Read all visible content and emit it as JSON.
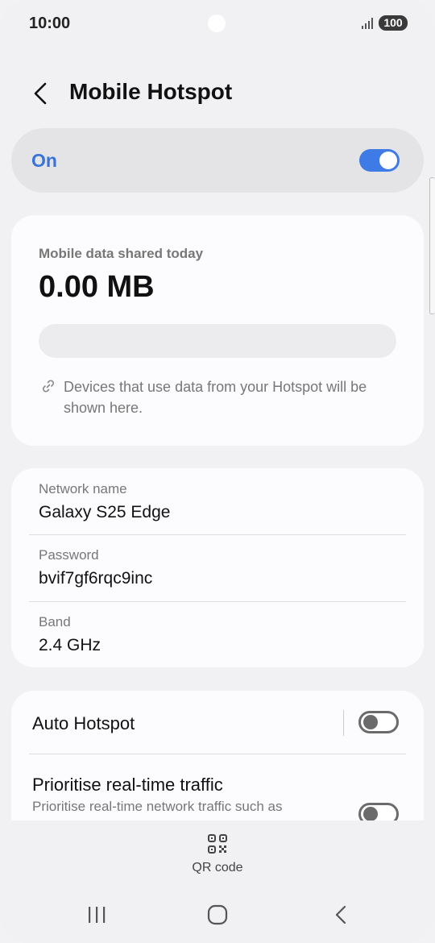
{
  "status": {
    "time": "10:00",
    "battery": "100"
  },
  "header": {
    "title": "Mobile Hotspot"
  },
  "hotspot": {
    "label": "On",
    "enabled": true
  },
  "usage": {
    "label": "Mobile data shared today",
    "amount": "0.00 MB",
    "progress_fraction": 0,
    "note": "Devices that use data from your Hotspot will be shown here."
  },
  "network": {
    "name_label": "Network name",
    "name_value": "Galaxy S25 Edge",
    "password_label": "Password",
    "password_value": "bvif7gf6rqc9inc",
    "band_label": "Band",
    "band_value": "2.4 GHz"
  },
  "options": {
    "auto_hotspot_label": "Auto Hotspot",
    "auto_hotspot_enabled": false,
    "prioritise_label": "Prioritise real-time traffic",
    "prioritise_sub": "Prioritise real-time network traffic such as",
    "prioritise_enabled": false
  },
  "qr": {
    "label": "QR code"
  },
  "icons": {
    "back": "back-arrow-icon",
    "link": "link-icon",
    "qr": "qr-code-icon",
    "signal": "signal-icon",
    "recents": "recents-icon",
    "home": "home-icon",
    "nav_back": "nav-back-icon"
  },
  "colors": {
    "accent": "#3f7be6",
    "on_text": "#3a73d8"
  }
}
